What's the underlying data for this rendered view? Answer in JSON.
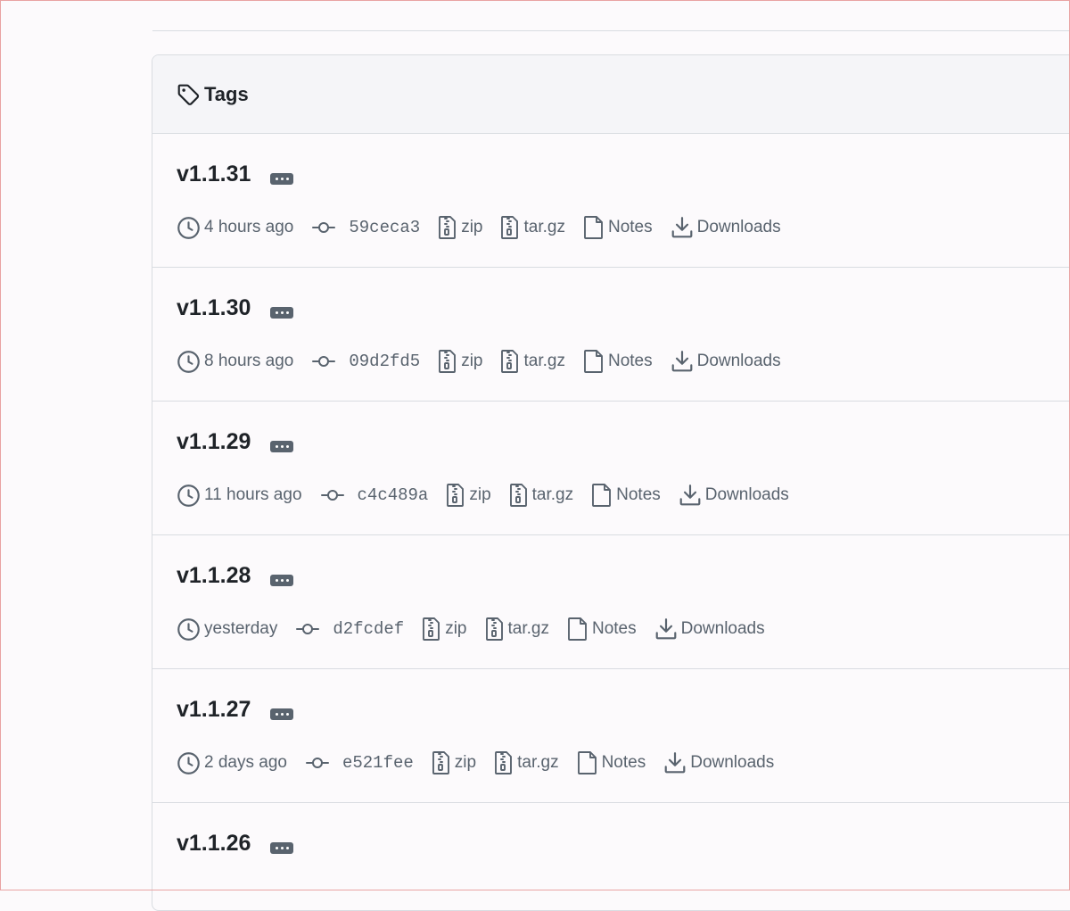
{
  "panel": {
    "title": "Tags",
    "tag_icon": "tag-icon"
  },
  "colors": {
    "text_primary": "#1f2328",
    "text_muted": "#59636e",
    "border": "#d9dce1",
    "header_bg": "#f5f5f8",
    "page_bg": "#fcfafc"
  },
  "icons": {
    "time": "clock-icon",
    "commit": "git-commit-icon",
    "zip": "file-zip-icon",
    "tar": "file-zip-icon",
    "notes": "file-icon",
    "downloads": "download-icon",
    "more": "kebab-horizontal-icon"
  },
  "tags": [
    {
      "name": "v1.1.31",
      "time": "4 hours ago",
      "sha": "59ceca3",
      "zip": "zip",
      "tar": "tar.gz",
      "notes": "Notes",
      "downloads": "Downloads"
    },
    {
      "name": "v1.1.30",
      "time": "8 hours ago",
      "sha": "09d2fd5",
      "zip": "zip",
      "tar": "tar.gz",
      "notes": "Notes",
      "downloads": "Downloads"
    },
    {
      "name": "v1.1.29",
      "time": "11 hours ago",
      "sha": "c4c489a",
      "zip": "zip",
      "tar": "tar.gz",
      "notes": "Notes",
      "downloads": "Downloads"
    },
    {
      "name": "v1.1.28",
      "time": "yesterday",
      "sha": "d2fcdef",
      "zip": "zip",
      "tar": "tar.gz",
      "notes": "Notes",
      "downloads": "Downloads"
    },
    {
      "name": "v1.1.27",
      "time": "2 days ago",
      "sha": "e521fee",
      "zip": "zip",
      "tar": "tar.gz",
      "notes": "Notes",
      "downloads": "Downloads"
    },
    {
      "name": "v1.1.26"
    }
  ]
}
